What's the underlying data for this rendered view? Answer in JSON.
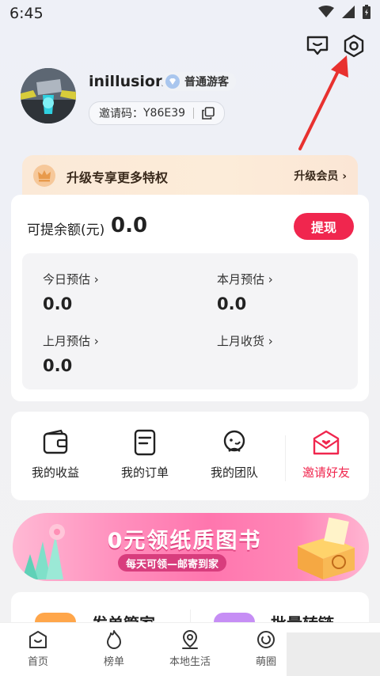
{
  "status_bar": {
    "time": "6:45"
  },
  "header_icons": {
    "message": "message-icon",
    "settings": "settings-icon"
  },
  "profile": {
    "username": "inillusion",
    "level_badge": "普通游客",
    "invite_label": "邀请码：",
    "invite_code": "Y86E39"
  },
  "upgrade": {
    "text": "升级专享更多特权",
    "link": "升级会员",
    "accent": "#3a2a1c"
  },
  "balance": {
    "label": "可提余额(元)",
    "value": "0.0",
    "withdraw": "提现",
    "withdraw_color": "#f0264e"
  },
  "stats": [
    {
      "label": "今日预估",
      "value": "0.0"
    },
    {
      "label": "本月预估",
      "value": "0.0"
    },
    {
      "label": "上月预估",
      "value": "0.0"
    },
    {
      "label": "上月收货",
      "value": ""
    }
  ],
  "menu": [
    {
      "label": "我的收益",
      "icon": "wallet-icon"
    },
    {
      "label": "我的订单",
      "icon": "order-icon"
    },
    {
      "label": "我的团队",
      "icon": "team-icon"
    },
    {
      "label": "邀请好友",
      "icon": "invite-icon",
      "color": "#f0264e"
    }
  ],
  "promo": {
    "title": "0元领纸质图书",
    "subtitle": "每天可领—邮寄到家"
  },
  "tools": [
    {
      "label": "发单管家"
    },
    {
      "label": "批量转链"
    }
  ],
  "bottom_nav": [
    {
      "label": "首页",
      "icon": "home-icon"
    },
    {
      "label": "榜单",
      "icon": "fire-icon"
    },
    {
      "label": "本地生活",
      "icon": "location-icon"
    },
    {
      "label": "萌圈",
      "icon": "circle-chat-icon"
    }
  ]
}
